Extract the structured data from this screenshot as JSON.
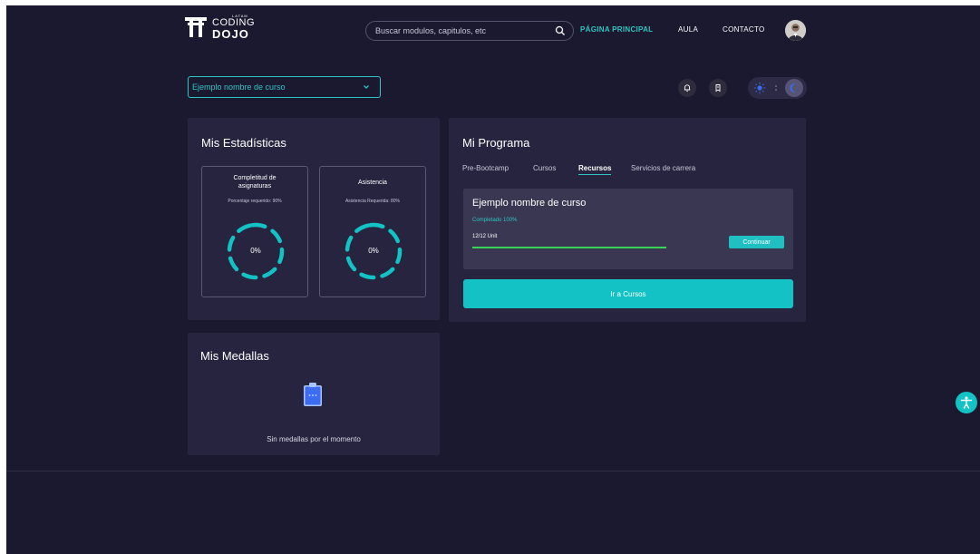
{
  "brand": {
    "latam": "LATAM",
    "coding": "CODING",
    "dojo": "DOJO"
  },
  "search": {
    "placeholder": "Buscar modulos, capitulos, etc"
  },
  "nav": {
    "home": "PÁGINA PRINCIPAL",
    "aula": "AULA",
    "contacto": "CONTACTO"
  },
  "course_selector": {
    "selected": "Ejemplo nombre de curso"
  },
  "stats": {
    "title": "Mis Estadísticas",
    "completion": {
      "label": "Completitud de asignaturas",
      "required": "Porcentaje requerido: 90%",
      "value": "0%"
    },
    "attendance": {
      "label": "Asistencia",
      "required": "Asistencia Requerida: 80%",
      "value": "0%"
    }
  },
  "program": {
    "title": "Mi Programa",
    "tabs": [
      {
        "label": "Pre-Bootcamp"
      },
      {
        "label": "Cursos"
      },
      {
        "label": "Recursos"
      },
      {
        "label": "Servicios de carrera"
      }
    ],
    "active_tab": "Recursos",
    "course": {
      "name": "Ejemplo nombre de curso",
      "completed": "Completado 100%",
      "units": "12/12 Unit",
      "progress_percent": 100,
      "continue_label": "Continuar"
    },
    "go_courses_label": "Ir a Cursos"
  },
  "medals": {
    "title": "Mis Medallas",
    "empty_text": "Sin medallas por el momento"
  },
  "colors": {
    "background": "#1b1930",
    "card": "#272440",
    "accent": "#2ec4c4",
    "progress": "#37d457"
  },
  "icons": {
    "search": "search-icon",
    "chevron": "chevron-down-icon",
    "bell": "bell-icon",
    "bookmark": "bookmark-icon",
    "sun": "sun-icon",
    "moon": "moon-icon",
    "clipboard": "clipboard-icon",
    "accessibility": "accessibility-icon"
  }
}
